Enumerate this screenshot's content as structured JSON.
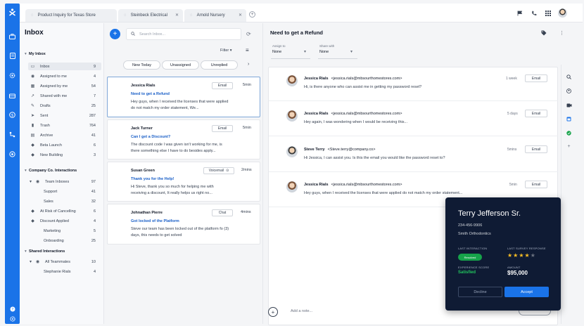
{
  "tabs": [
    {
      "label": "Product Inquiry for Texas Store"
    },
    {
      "label": "Steinbeck Electrical"
    },
    {
      "label": "Arnold Nursery"
    }
  ],
  "sidebar": {
    "title": "Inbox",
    "sections": {
      "my_inbox": "My Inbox",
      "company": "Company Co. Interactions",
      "shared": "Shared Interactions"
    },
    "my_items": [
      {
        "label": "Inbox",
        "count": "9"
      },
      {
        "label": "Assigned to me",
        "count": "4"
      },
      {
        "label": "Assigned by me",
        "count": "54"
      },
      {
        "label": "Shared with me",
        "count": "7"
      },
      {
        "label": "Drafts",
        "count": "25"
      },
      {
        "label": "Sent",
        "count": "287"
      },
      {
        "label": "Trash",
        "count": "764"
      },
      {
        "label": "Archive",
        "count": "41"
      },
      {
        "label": "Beta Launch",
        "count": "6"
      },
      {
        "label": "New Building",
        "count": "3"
      }
    ],
    "company_items": [
      {
        "label": "Team Inboxes",
        "count": "97"
      },
      {
        "label": "Support",
        "count": "41"
      },
      {
        "label": "Sales",
        "count": "32"
      },
      {
        "label": "At Risk of Cancelling",
        "count": "6"
      },
      {
        "label": "Discount Applied",
        "count": "4"
      },
      {
        "label": "Marketing",
        "count": "5"
      },
      {
        "label": "Onboarding",
        "count": "25"
      }
    ],
    "shared_items": [
      {
        "label": "All Teammates",
        "count": "10"
      },
      {
        "label": "Stephanie Rials",
        "count": "4"
      }
    ]
  },
  "list": {
    "search_placeholder": "Search Inbox...",
    "filter_label": "Filter",
    "pills": [
      "New Today",
      "Unassigned",
      "Unreplied"
    ],
    "cards": [
      {
        "name": "Jessica Rials",
        "subject": "Need to get a Refund",
        "preview": "Hey guys, when I received the licenses that were applied do not match my order statement, We...",
        "chip": "Email",
        "time": "5min"
      },
      {
        "name": "Jack Turner",
        "subject": "Can I get a Discount?",
        "preview": "The discount code I was given isn't working for me, is there something else I have to do besides apply...",
        "chip": "Email",
        "time": "5min"
      },
      {
        "name": "Susan Green",
        "subject": "Thank you for the Help!",
        "preview": "Hi Steve, thank you so much for helping me with receiving a discount, It really helps us right no...",
        "chip": "Voicemail",
        "time": "2mins"
      },
      {
        "name": "Johnathan Pierre",
        "subject": "Got locked of the Platform",
        "preview": "Steve our team has been locked out of the platform fo (3) days, this needs to get solved",
        "chip": "Chat",
        "time": "4mins"
      }
    ]
  },
  "thread": {
    "title": "Need to get a Refund",
    "assign_label": "Assign to",
    "assign_value": "None",
    "show_label": "Share with",
    "show_value": "None",
    "messages": [
      {
        "from": "Jessica Rials",
        "email": "<jessica.rials@mbsourthomestores.com>",
        "body": "Hi, is there anyone who can assist me in getting my password reset?",
        "time": "1 week",
        "chip": "Email",
        "male": false
      },
      {
        "from": "Jessica Rials",
        "email": "<jessica.rials@mbsourthomestores.com>",
        "body": "Hey again, I was wondering when I would be receiving this...",
        "time": "5 days",
        "chip": "Email",
        "male": false
      },
      {
        "from": "Steve Terry",
        "email": "<Steve.terry@company.co>",
        "body": "Hi Jessica, I can assist you.  Is this the email you would like the password reset to?",
        "time": "5mins",
        "chip": "Email",
        "male": true
      },
      {
        "from": "Jessica Rials",
        "email": "<jessica.rials@mbsourthomestores.com>",
        "body": "Hey guys, when I received the licenses that were applied do not match my order statement...",
        "time": "5min",
        "chip": "Email",
        "male": false
      }
    ],
    "note_placeholder": "Add a note..."
  },
  "popup": {
    "name": "Terry Jefferson Sr.",
    "phone": "234-456-9906",
    "org": "Smith Orthodontics",
    "last_interaction_label": "LAST INTERACTION",
    "last_interaction_badge": "Resolved",
    "survey_label": "LAST SURVEY RESPONSE",
    "rating": 4,
    "rating_max": 5,
    "score_label": "EXPERIENCE SCORE",
    "score_value": "Satisfied",
    "amount_label": "AMOUNT",
    "amount_value": "$95,000",
    "decline_label": "Decline",
    "accept_label": "Accept"
  },
  "colors": {
    "brand": "#1a73e8",
    "popup_bg": "#0f1b34",
    "success": "#22c55e",
    "star": "#fbbf24"
  }
}
